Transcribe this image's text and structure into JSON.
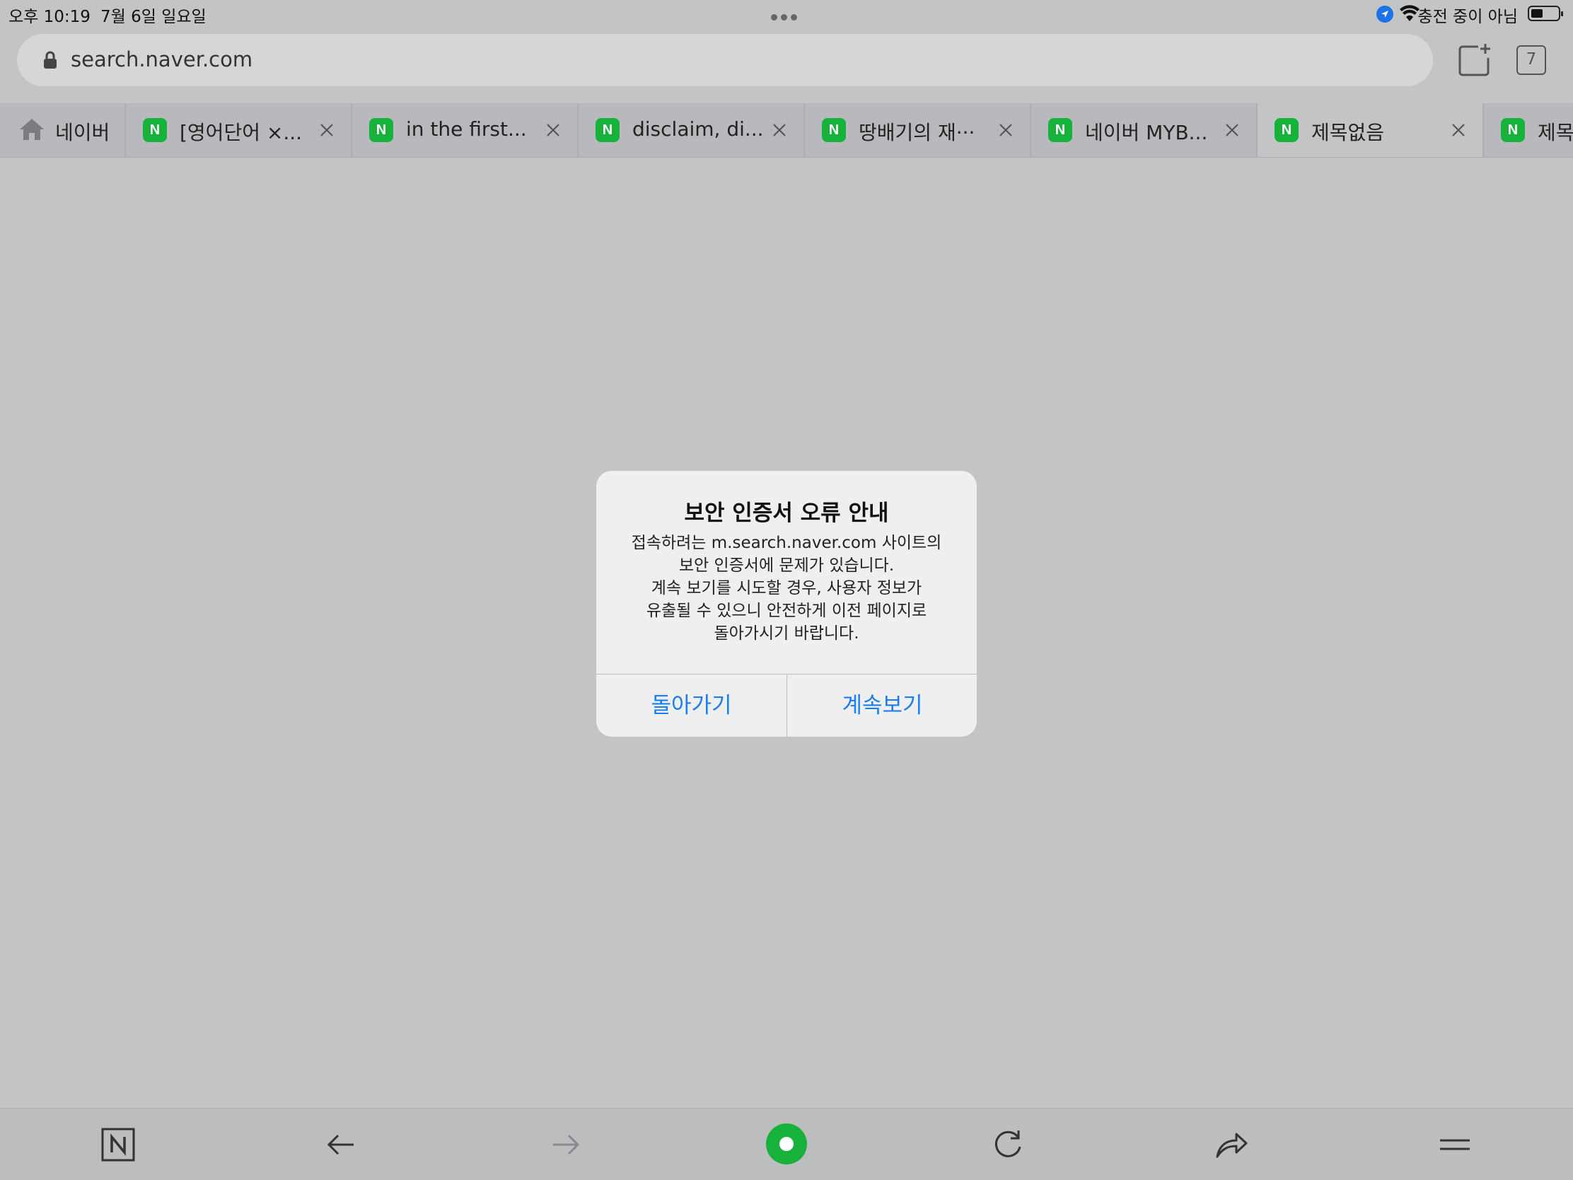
{
  "status_bar": {
    "time": "오후 10:19",
    "date": "7월 6일 일요일",
    "charging": "충전 중이 아님",
    "location_color": "#1a73e8"
  },
  "address_bar": {
    "url": "search.naver.com"
  },
  "toolbar_top": {
    "tab_count": "7"
  },
  "tabs": [
    {
      "label": "네이버",
      "icon": "home-icon"
    },
    {
      "label": "[영어단어 ×...",
      "icon": "naver-n-icon",
      "close": true
    },
    {
      "label": "in the first...",
      "icon": "naver-n-icon",
      "close": true
    },
    {
      "label": "disclaim, di...",
      "icon": "naver-n-icon",
      "close": true
    },
    {
      "label": "땅배기의 재···",
      "icon": "naver-n-icon",
      "close": true
    },
    {
      "label": "네이버 MYB...",
      "icon": "naver-n-icon",
      "close": true
    },
    {
      "label": "제목없음",
      "icon": "naver-n-icon",
      "close": true,
      "active": true
    },
    {
      "label": "제목",
      "icon": "naver-n-icon"
    }
  ],
  "naver_icon_letter": "N",
  "dialog": {
    "title": "보안 인증서 오류 안내",
    "message_lines": [
      "접속하려는 m.search.naver.com 사이트의",
      "보안 인증서에 문제가 있습니다.",
      "계속 보기를 시도할 경우, 사용자 정보가",
      "유출될 수 있으니 안전하게 이전 페이지로",
      "돌아가시기 바랍니다."
    ],
    "back_label": "돌아가기",
    "continue_label": "계속보기",
    "button_color": "#1a7ef2"
  },
  "bottom_toolbar": {
    "items": [
      "naver-home-icon",
      "back-arrow-icon",
      "forward-arrow-icon",
      "green-dot-icon",
      "reload-icon",
      "share-icon",
      "menu-icon"
    ],
    "green_dot_color": "#16b23b"
  }
}
